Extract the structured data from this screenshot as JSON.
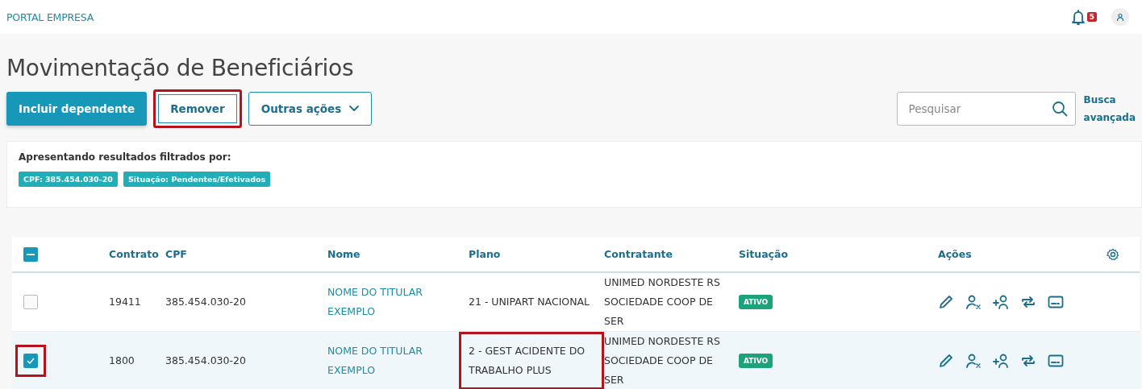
{
  "header": {
    "brand": "PORTAL EMPRESA",
    "notification_count": "5"
  },
  "title": "Movimentação de Beneficiários",
  "actions": [
    {
      "label": "Incluir dependente",
      "kind": "primary",
      "highlighted": false
    },
    {
      "label": "Remover",
      "kind": "secondary",
      "highlighted": true
    },
    {
      "label": "Outras ações",
      "kind": "dropdown",
      "highlighted": false
    }
  ],
  "search": {
    "placeholder": "Pesquisar"
  },
  "advanced_search": "Busca avançada",
  "filters": {
    "label": "Apresentando resultados filtrados por:",
    "tags": [
      "CPF: 385.454.030-20",
      "Situação: Pendentes/Efetivados"
    ]
  },
  "table": {
    "select_all_indeterminate": true,
    "columns": [
      "Contrato",
      "CPF",
      "Nome",
      "Plano",
      "Contratante",
      "Situação",
      "Ações"
    ],
    "rows": [
      {
        "checked": false,
        "checkbox_highlighted": false,
        "contrato": "19411",
        "cpf": "385.454.030-20",
        "nome": "NOME DO TITULAR EXEMPLO",
        "plano": "21 - UNIPART NACIONAL",
        "plano_highlighted": false,
        "contratante": "UNIMED NORDESTE RS SOCIEDADE COOP DE SER",
        "situacao": "ATIVO"
      },
      {
        "checked": true,
        "checkbox_highlighted": true,
        "contrato": "1800",
        "cpf": "385.454.030-20",
        "nome": "NOME DO TITULAR EXEMPLO",
        "plano": "2 - GEST ACIDENTE DO TRABALHO PLUS",
        "plano_highlighted": true,
        "contratante": "UNIMED NORDESTE RS SOCIEDADE COOP DE SER",
        "situacao": "ATIVO"
      }
    ]
  }
}
